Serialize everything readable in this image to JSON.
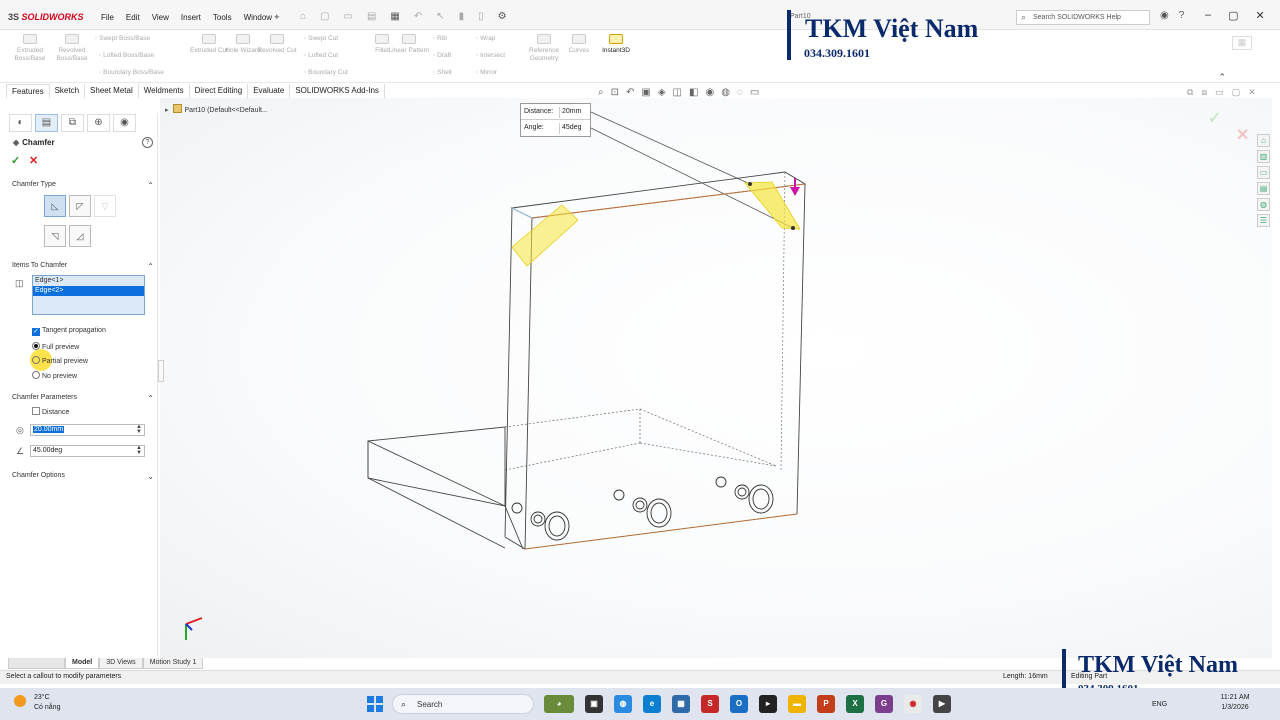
{
  "app": {
    "logo": "SOLIDWORKS",
    "logo_prefix": "3S",
    "menu": [
      "File",
      "Edit",
      "View",
      "Insert",
      "Tools",
      "Window"
    ],
    "filename": "Part10",
    "help_search_placeholder": "Search SOLIDWORKS Help"
  },
  "watermark": {
    "name": "TKM Việt Nam",
    "phone": "034.309.1601"
  },
  "ribbon": {
    "large_buttons": [
      {
        "label": "Extruded Boss/Base",
        "icon": "extrude-icon"
      },
      {
        "label": "Revolved Boss/Base",
        "icon": "revolve-icon"
      },
      {
        "label": "Extruded Cut",
        "icon": "extruded-cut-icon"
      },
      {
        "label": "Hole Wizard",
        "icon": "hole-wizard-icon"
      },
      {
        "label": "Revolved Cut",
        "icon": "revolved-cut-icon"
      },
      {
        "label": "Fillet",
        "icon": "fillet-icon"
      },
      {
        "label": "Linear Pattern",
        "icon": "linear-pattern-icon"
      },
      {
        "label": "Reference Geometry",
        "icon": "reference-geometry-icon"
      },
      {
        "label": "Curves",
        "icon": "curves-icon"
      },
      {
        "label": "Instant3D",
        "icon": "instant3d-icon"
      }
    ],
    "small_buttons": [
      "Swept Boss/Base",
      "Lofted Boss/Base",
      "Boundary Boss/Base",
      "Swept Cut",
      "Lofted Cut",
      "Boundary Cut",
      "Rib",
      "Draft",
      "Shell",
      "Wrap",
      "Intersect",
      "Mirror"
    ]
  },
  "command_tabs": [
    "Features",
    "Sketch",
    "Sheet Metal",
    "Weldments",
    "Direct Editing",
    "Evaluate",
    "SOLIDWORKS Add-Ins"
  ],
  "tree": {
    "root": "Part10 (Default<<Default..."
  },
  "callout": {
    "distance_label": "Distance:",
    "distance_value": "20mm",
    "angle_label": "Angle:",
    "angle_value": "45deg"
  },
  "property_manager": {
    "title": "Chamfer",
    "ok_icon": "check-icon",
    "cancel_icon": "close-icon",
    "sections": {
      "chamfer_type": "Chamfer Type",
      "items_to_chamfer": "Items To Chamfer",
      "chamfer_parameters": "Chamfer Parameters",
      "chamfer_options": "Chamfer Options"
    },
    "items": [
      "Edge<1>",
      "Edge<2>"
    ],
    "tangent_propagation": "Tangent propagation",
    "preview_options": [
      "Full preview",
      "Partial preview",
      "No preview"
    ],
    "selected_preview": "Full preview",
    "flip_direction_label": "Distance",
    "distance_value": "20.00mm",
    "angle_value": "45.00deg"
  },
  "bottom_tabs": [
    "Model",
    "3D Views",
    "Motion Study 1"
  ],
  "status": {
    "message": "Select a callout to modify parameters",
    "length": "Length: 16mm",
    "mode": "Editing Part"
  },
  "taskbar": {
    "temperature": "23°C",
    "weather": "Có nắng",
    "search": "Search",
    "language": "ENG",
    "time": "11:21 AM",
    "date": "1/3/2026"
  },
  "colors": {
    "accent": "#0d6fdb",
    "watermark": "#0a2a6b",
    "highlight_yellow": "#f5e63c",
    "edge_orange": "#c0743a",
    "drag_arrow": "#cc14a8"
  }
}
